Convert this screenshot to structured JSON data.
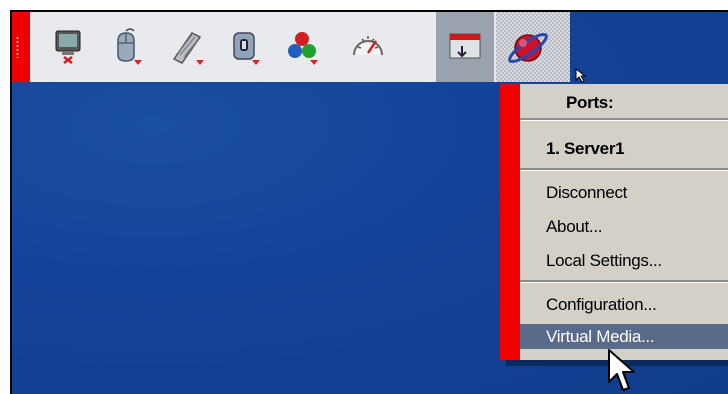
{
  "toolbar": {
    "buttons": [
      {
        "icon": "monitor-disconnect-icon"
      },
      {
        "icon": "mouse-icon"
      },
      {
        "icon": "keyboard-icon"
      },
      {
        "icon": "memory-icon"
      },
      {
        "icon": "color-icon"
      },
      {
        "icon": "gauge-icon"
      },
      {
        "icon": "window-icon"
      },
      {
        "icon": "globe-menu-icon"
      }
    ],
    "accent": "#ee0000"
  },
  "menu": {
    "header": "Ports:",
    "server": "1. Server1",
    "items_group1": [
      "Disconnect",
      "About...",
      "Local Settings..."
    ],
    "items_group2": [
      "Configuration...",
      "Virtual Media..."
    ],
    "highlighted": "Virtual Media..."
  },
  "colors": {
    "desktop": "#14449a",
    "menu_bg": "#d4d0c8",
    "menu_bar": "#f00000",
    "highlight": "#5a6a8a"
  }
}
